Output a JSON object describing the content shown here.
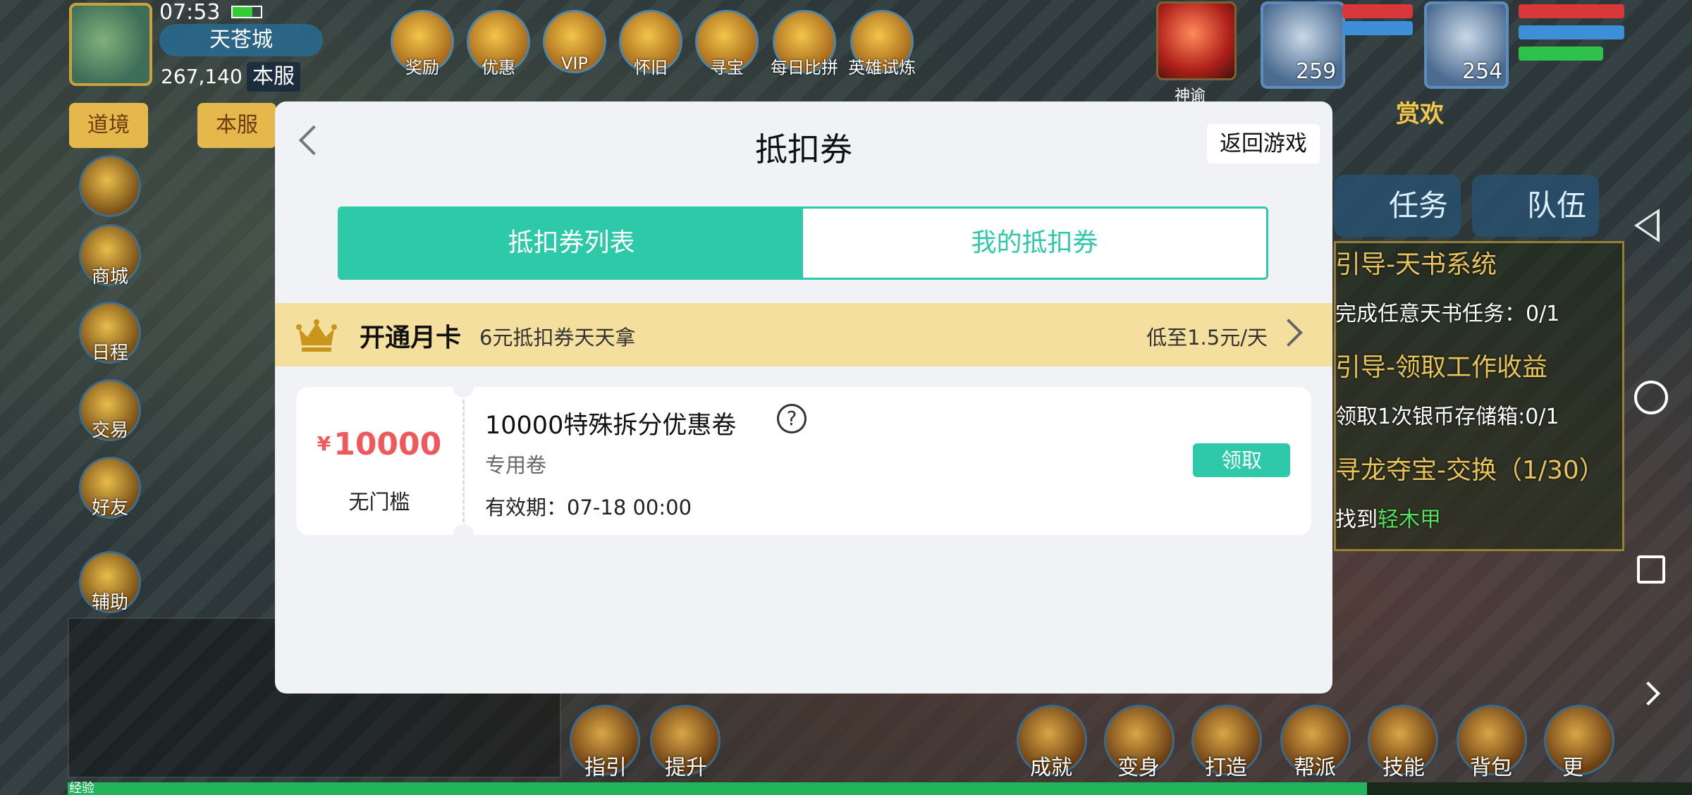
{
  "game": {
    "time": "07:53",
    "city": "天苍城",
    "power": "267,140",
    "server_tag": "本服",
    "left_menu": [
      "道境",
      "本服"
    ],
    "side_icons": [
      "商城",
      "日程",
      "交易",
      "好友",
      "辅助"
    ],
    "top_icons": [
      "奖励",
      "优惠",
      "VIP",
      "怀旧",
      "寻宝",
      "每日比拼",
      "英雄试炼"
    ],
    "orb_label": "神谕",
    "portraits": [
      {
        "level": "259"
      },
      {
        "level": "254"
      }
    ],
    "reward_text": "赏欢",
    "task_tabs": [
      "任务",
      "队伍"
    ],
    "tasks": [
      {
        "title": "引导-天书系统",
        "detail": "完成任意天书任务：0/1"
      },
      {
        "title": "引导-领取工作收益",
        "detail": "领取1次银币存储箱:0/1"
      },
      {
        "title": "寻龙夺宝-交换（1/30）",
        "detail_prefix": "找到",
        "detail_highlight": "轻木甲"
      }
    ],
    "bottom_icons": [
      "指引",
      "提升",
      "成就",
      "变身",
      "打造",
      "帮派",
      "技能",
      "背包",
      "更"
    ],
    "exp_label": "经验",
    "exp_progress": 0.8
  },
  "modal": {
    "title": "抵扣券",
    "return_label": "返回游戏",
    "tabs": [
      {
        "label": "抵扣券列表",
        "active": true
      },
      {
        "label": "我的抵扣券",
        "active": false
      }
    ],
    "banner": {
      "title": "开通月卡",
      "subtitle": "6元抵扣券天天拿",
      "price": "低至1.5元/天"
    },
    "coupons": [
      {
        "currency": "¥",
        "amount": "10000",
        "threshold": "无门槛",
        "name": "10000特殊拆分优惠卷",
        "type": "专用卷",
        "validity": "有效期：07-18 00:00",
        "action": "领取"
      }
    ]
  },
  "colors": {
    "accent": "#2dc9a9",
    "price_red": "#f0595b",
    "banner_bg": "#f4df9f"
  }
}
